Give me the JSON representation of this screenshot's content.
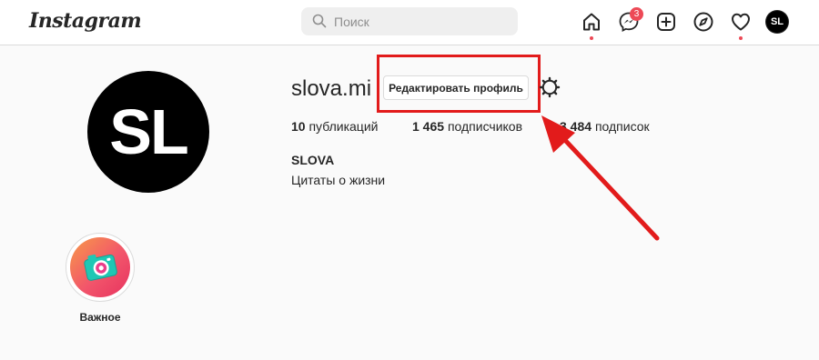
{
  "header": {
    "logo_text": "Instagram",
    "search_placeholder": "Поиск",
    "messages_badge": "3",
    "avatar_initials": "SL"
  },
  "icons": {
    "search": "search-icon",
    "home": "home-icon",
    "messenger": "messenger-icon",
    "new_post": "plus-square-icon",
    "explore": "compass-icon",
    "activity": "heart-icon",
    "settings": "gear-icon"
  },
  "profile": {
    "avatar_initials": "SL",
    "username": "slova.mi",
    "edit_button_label": "Редактировать профиль",
    "stats": [
      {
        "value": "10",
        "label": "публикаций"
      },
      {
        "value": "1 465",
        "label": "подписчиков"
      },
      {
        "value": "3 484",
        "label": "подписок"
      }
    ],
    "full_name": "SLOVA",
    "bio": "Цитаты о жизни"
  },
  "highlights": [
    {
      "label": "Важное"
    }
  ],
  "colors": {
    "annotation": "#e21b1b",
    "notification": "#ed4956",
    "border": "#dbdbdb"
  }
}
